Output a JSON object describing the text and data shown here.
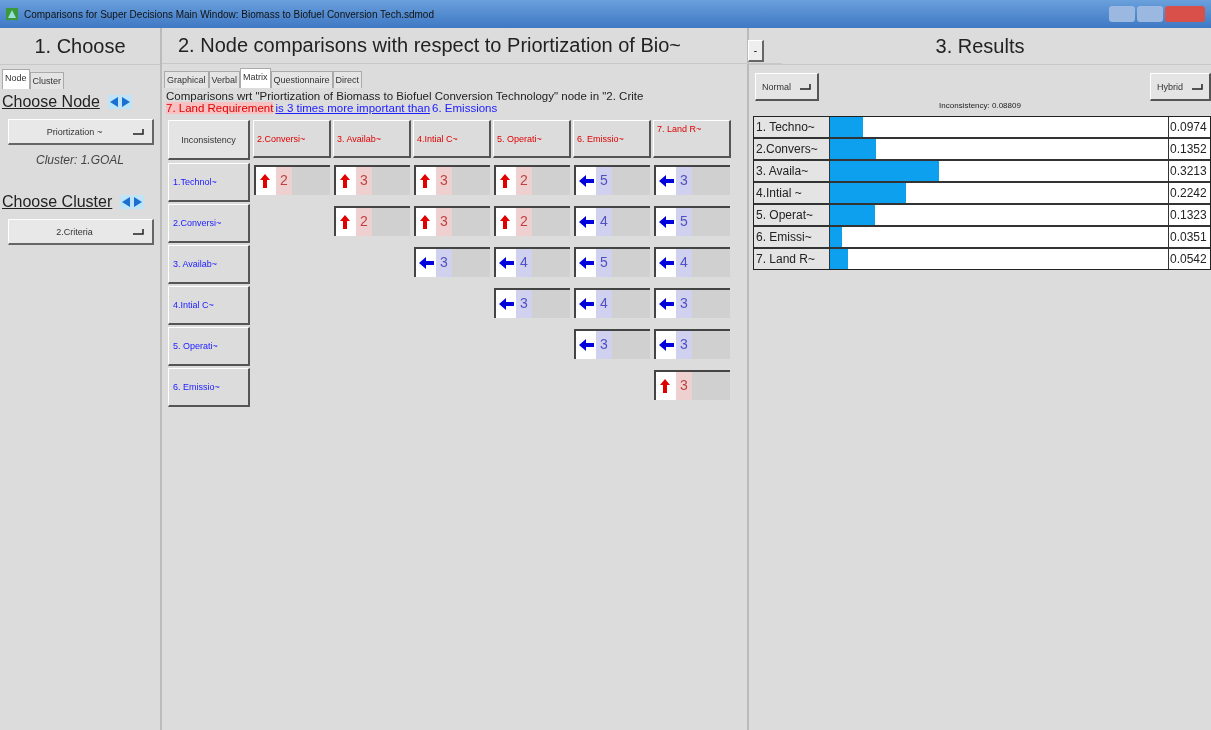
{
  "window": {
    "title": "Comparisons for Super Decisions Main Window: Biomass to Biofuel Conversion Tech.sdmod"
  },
  "choose": {
    "title": "1. Choose",
    "tabs": [
      {
        "label": "Node",
        "selected": true
      },
      {
        "label": "Cluster",
        "selected": false
      }
    ],
    "node_heading": "Choose Node",
    "node_value": "Priortization ~",
    "cluster_info": "Cluster: 1.GOAL",
    "cluster_heading": "Choose Cluster",
    "cluster_value": "2.Criteria"
  },
  "comparisons": {
    "title": "2. Node comparisons with respect to Priortization of Bio~",
    "tabs": [
      {
        "label": "Graphical",
        "selected": false
      },
      {
        "label": "Verbal",
        "selected": false
      },
      {
        "label": "Matrix",
        "selected": true
      },
      {
        "label": "Questionnaire",
        "selected": false
      },
      {
        "label": "Direct",
        "selected": false
      }
    ],
    "description": "Comparisons wrt \"Priortization of Biomass to Biofuel Conversion Technology\" node in \"2. Crite",
    "statement": [
      {
        "kind": "node",
        "text": "7. Land Requirement"
      },
      {
        "kind": "link",
        "text": "is 3 times more important than"
      },
      {
        "kind": "other",
        "text": "6. Emissions"
      }
    ],
    "inconsistency_button": "Inconsistency",
    "columns": [
      "2.Conversi~",
      "3. Availab~",
      "4.Intial C~",
      "5. Operati~",
      "6. Emissio~",
      "7. Land R~"
    ],
    "rows": [
      {
        "label": "1.Technol~",
        "cells": [
          {
            "kind": "up",
            "value": "2"
          },
          {
            "kind": "up",
            "value": "3"
          },
          {
            "kind": "up",
            "value": "3"
          },
          {
            "kind": "up",
            "value": "2"
          },
          {
            "kind": "left",
            "value": "5"
          },
          {
            "kind": "left",
            "value": "3"
          }
        ]
      },
      {
        "label": "2.Conversi~",
        "cells": [
          "",
          {
            "kind": "up",
            "value": "2"
          },
          {
            "kind": "up",
            "value": "3"
          },
          {
            "kind": "up",
            "value": "2"
          },
          {
            "kind": "left",
            "value": "4"
          },
          {
            "kind": "left",
            "value": "5"
          }
        ]
      },
      {
        "label": "3. Availab~",
        "cells": [
          "",
          "",
          {
            "kind": "left",
            "value": "3"
          },
          {
            "kind": "left",
            "value": "4"
          },
          {
            "kind": "left",
            "value": "5"
          },
          {
            "kind": "left",
            "value": "4"
          }
        ]
      },
      {
        "label": "4.Intial C~",
        "cells": [
          "",
          "",
          "",
          {
            "kind": "left",
            "value": "3"
          },
          {
            "kind": "left",
            "value": "4"
          },
          {
            "kind": "left",
            "value": "3"
          }
        ]
      },
      {
        "label": "5. Operati~",
        "cells": [
          "",
          "",
          "",
          "",
          {
            "kind": "left",
            "value": "3"
          },
          {
            "kind": "left",
            "value": "3"
          }
        ]
      },
      {
        "label": "6. Emissio~",
        "cells": [
          "",
          "",
          "",
          "",
          "",
          {
            "kind": "up",
            "value": "3"
          }
        ]
      }
    ]
  },
  "collapse_button": "-",
  "results": {
    "title": "3. Results",
    "mode_button": "Normal",
    "view_button": "Hybrid",
    "inconsistency": "Inconsistency: 0.08809",
    "items": [
      {
        "label": "1. Techno~",
        "level": 0.0974,
        "value": "0.0974"
      },
      {
        "label": "2.Convers~",
        "level": 0.1352,
        "value": "0.1352"
      },
      {
        "label": "3. Availa~",
        "level": 0.3213,
        "value": "0.3213"
      },
      {
        "label": "4.Intial ~",
        "level": 0.2242,
        "value": "0.2242"
      },
      {
        "label": "5. Operat~",
        "level": 0.1323,
        "value": "0.1323"
      },
      {
        "label": "6. Emissi~",
        "level": 0.0351,
        "value": "0.0351"
      },
      {
        "label": "7. Land R~",
        "level": 0.0542,
        "value": "0.0542"
      }
    ]
  }
}
